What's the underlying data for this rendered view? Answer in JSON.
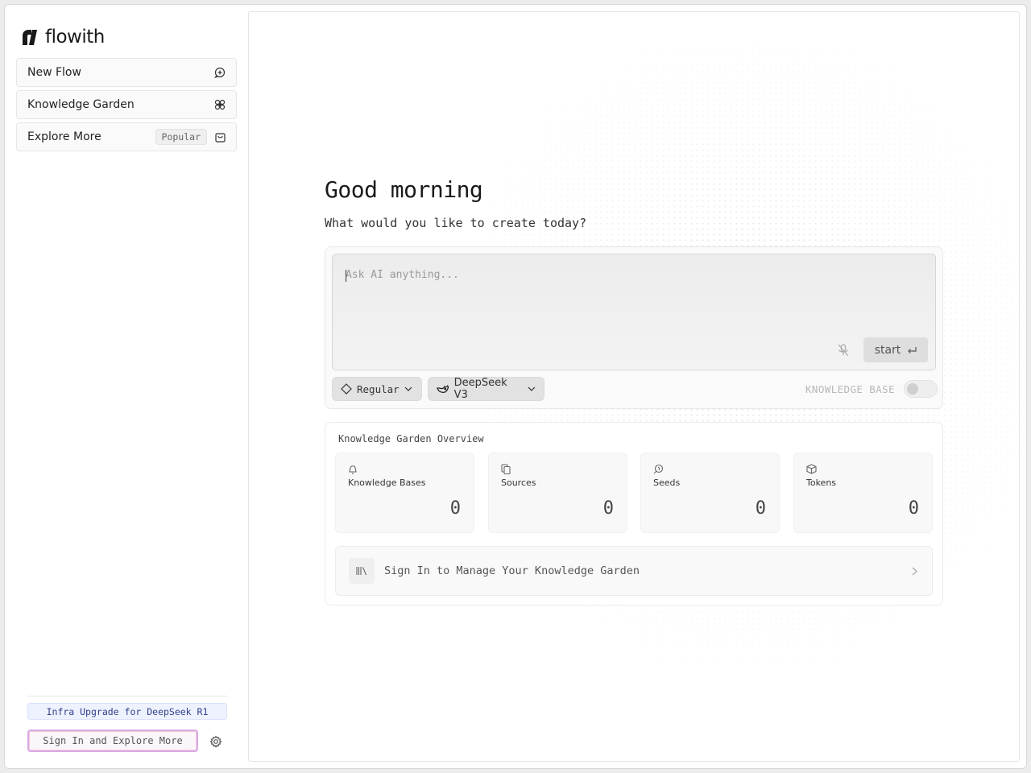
{
  "app": {
    "brand": "flowith"
  },
  "sidebar": {
    "items": [
      {
        "label": "New Flow",
        "icon": "chat-plus-icon"
      },
      {
        "label": "Knowledge Garden",
        "icon": "flower-icon"
      },
      {
        "label": "Explore More",
        "badge": "Popular",
        "icon": "bag-icon"
      }
    ],
    "promo": "Infra Upgrade for DeepSeek R1",
    "signin_label": "Sign In and Explore More"
  },
  "main": {
    "greeting": "Good morning",
    "subtitle": "What would you like to create today?",
    "composer": {
      "placeholder": "Ask AI anything...",
      "start_label": "start",
      "mode": "Regular",
      "model": "DeepSeek V3",
      "knowledge_base_label": "KNOWLEDGE BASE",
      "knowledge_base_enabled": false
    },
    "overview": {
      "title": "Knowledge Garden Overview",
      "stats": [
        {
          "label": "Knowledge Bases",
          "value": "0",
          "icon": "bell-icon"
        },
        {
          "label": "Sources",
          "value": "0",
          "icon": "copy-icon"
        },
        {
          "label": "Seeds",
          "value": "0",
          "icon": "seed-icon"
        },
        {
          "label": "Tokens",
          "value": "0",
          "icon": "cube-icon"
        }
      ],
      "manage_label": "Sign In to Manage Your Knowledge Garden"
    }
  },
  "colors": {
    "promo_bg": "#eef2ff",
    "signin_border": "#d9a9e8"
  }
}
